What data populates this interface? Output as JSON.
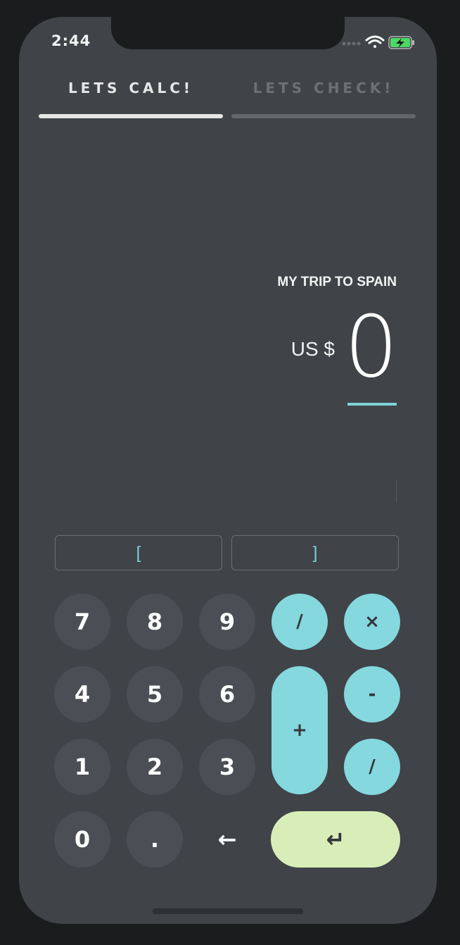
{
  "status_bar": {
    "time": "2:44",
    "signal_icon": "signal-dots-icon",
    "wifi_icon": "wifi-icon",
    "battery_icon": "battery-charging-icon"
  },
  "tabs": [
    {
      "label": "LETS CALC!",
      "active": true
    },
    {
      "label": "LETS CHECK!",
      "active": false
    }
  ],
  "trip": {
    "title": "MY TRIP TO SPAIN",
    "currency": "US $",
    "amount": "0"
  },
  "brackets": {
    "open": "[",
    "close": "]"
  },
  "keypad": {
    "k7": "7",
    "k8": "8",
    "k9": "9",
    "k4": "4",
    "k5": "5",
    "k6": "6",
    "k1": "1",
    "k2": "2",
    "k3": "3",
    "k0": "0",
    "dot": ".",
    "backspace": "←",
    "divide_top": "/",
    "multiply": "×",
    "plus": "+",
    "minus": "-",
    "divide_bottom": "/",
    "enter": "↵"
  },
  "colors": {
    "accent": "#84d8de",
    "enter": "#d9edb8",
    "background": "#404348",
    "key": "#4b4e54"
  }
}
